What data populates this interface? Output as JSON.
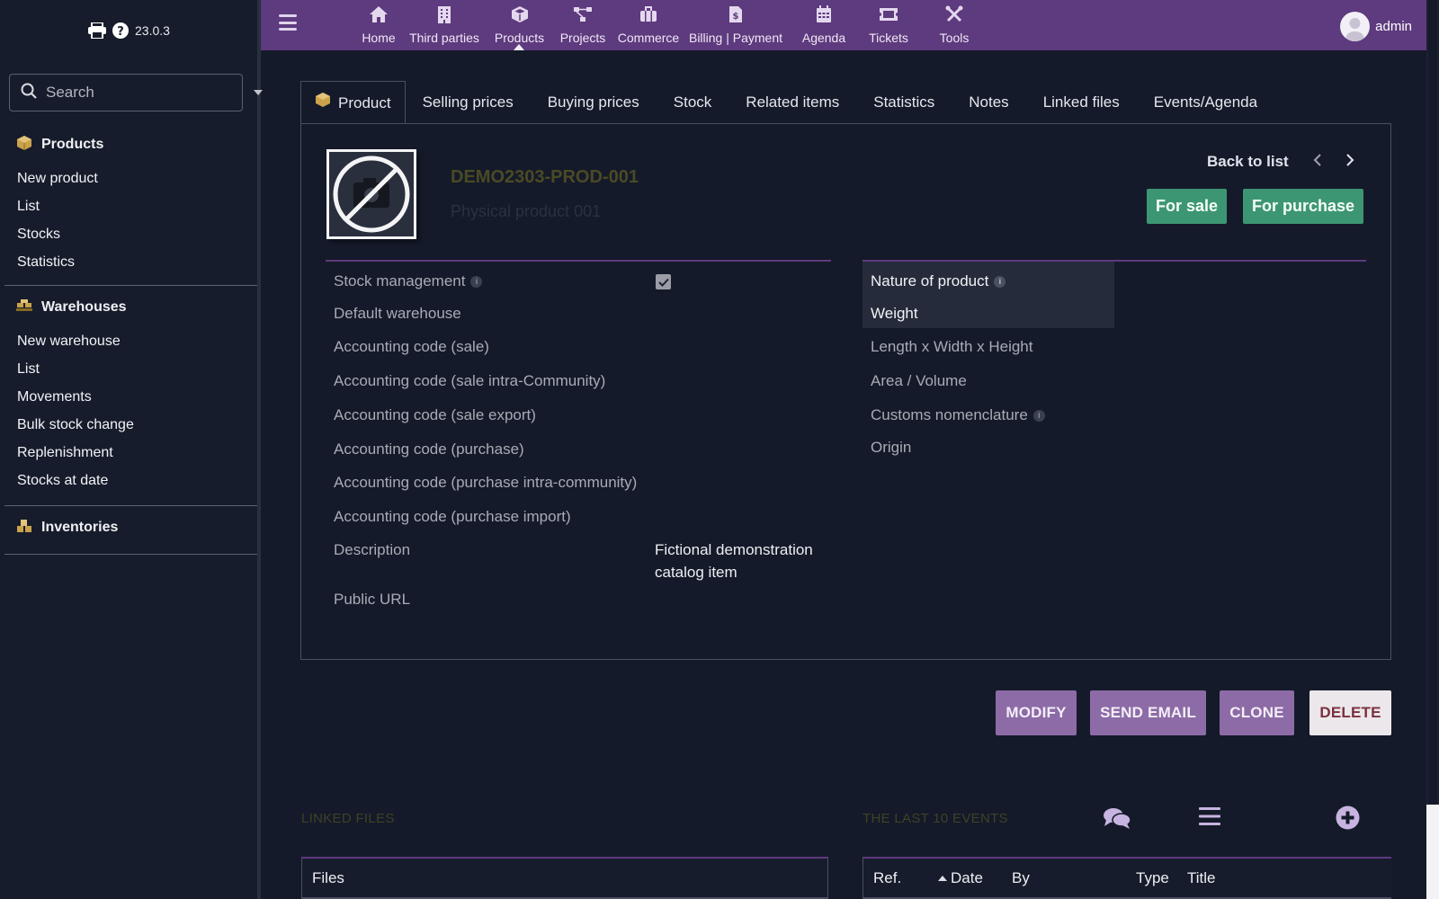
{
  "app": {
    "version": "23.0.3"
  },
  "sidebar": {
    "search_placeholder": "Search",
    "groups": [
      {
        "title": "Products",
        "items": [
          "New product",
          "List",
          "Stocks",
          "Statistics"
        ]
      },
      {
        "title": "Warehouses",
        "items": [
          "New warehouse",
          "List",
          "Movements",
          "Bulk stock change",
          "Replenishment",
          "Stocks at date"
        ]
      },
      {
        "title": "Inventories",
        "items": []
      }
    ]
  },
  "topnav": {
    "items": [
      {
        "label": "Home",
        "icon": "home-icon"
      },
      {
        "label": "Third parties",
        "icon": "building-icon"
      },
      {
        "label": "Products",
        "icon": "cube-icon",
        "active": true
      },
      {
        "label": "Projects",
        "icon": "project-icon"
      },
      {
        "label": "Commerce",
        "icon": "briefcase-icon"
      },
      {
        "label": "Billing | Payment",
        "icon": "invoice-icon"
      },
      {
        "label": "Agenda",
        "icon": "calendar-icon"
      },
      {
        "label": "Tickets",
        "icon": "ticket-icon"
      },
      {
        "label": "Tools",
        "icon": "tools-icon"
      }
    ],
    "user": "admin"
  },
  "tabs": [
    "Product",
    "Selling prices",
    "Buying prices",
    "Stock",
    "Related items",
    "Statistics",
    "Notes",
    "Linked files",
    "Events/Agenda"
  ],
  "product": {
    "ref": "DEMO2303-PROD-001",
    "label": "Physical product 001",
    "back_to_list": "Back to list",
    "status_sale": "For sale",
    "status_purchase": "For purchase",
    "stock_management_checked": true,
    "description": "Fictional demonstration catalog item"
  },
  "fields_left": [
    "Stock management",
    "Default warehouse",
    "Accounting code (sale)",
    "Accounting code (sale intra-Community)",
    "Accounting code (sale export)",
    "Accounting code (purchase)",
    "Accounting code (purchase intra-community)",
    "Accounting code (purchase import)",
    "Description",
    "Public URL"
  ],
  "fields_right": [
    "Nature of product",
    "Weight",
    "Length x Width x Height",
    "Area / Volume",
    "Customs nomenclature",
    "Origin"
  ],
  "actions": {
    "modify": "MODIFY",
    "send_email": "SEND EMAIL",
    "clone": "CLONE",
    "delete": "DELETE"
  },
  "linked_files": {
    "title": "LINKED FILES",
    "columns": [
      "Files"
    ]
  },
  "events": {
    "title": "THE LAST 10 EVENTS",
    "columns": [
      "Ref.",
      "Date",
      "By",
      "Type",
      "Title"
    ]
  },
  "colors": {
    "topbar": "#5e3a7e",
    "accent_green": "#3d9673",
    "button_purple": "#8c6ba6",
    "background": "#141a29"
  }
}
